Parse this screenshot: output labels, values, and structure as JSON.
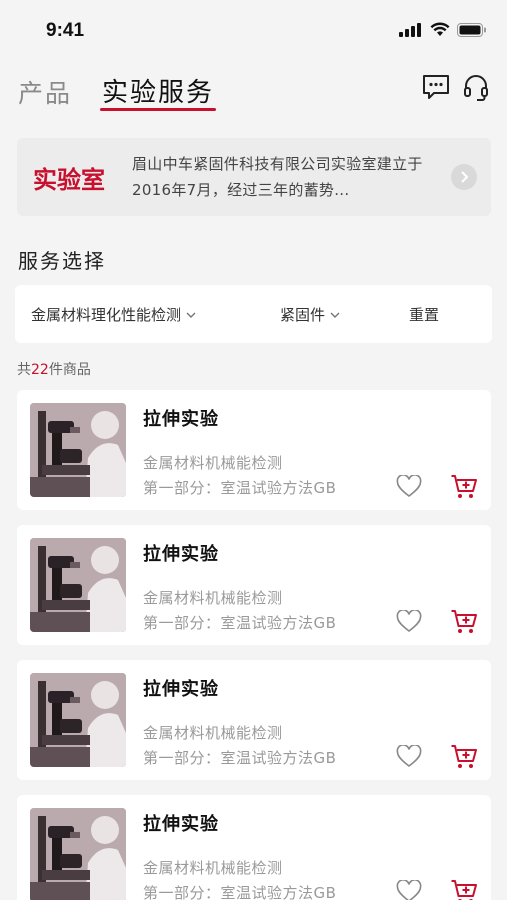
{
  "status_bar": {
    "time": "9:41"
  },
  "top_nav": {
    "tabs": [
      {
        "label": "产品",
        "active": false
      },
      {
        "label": "实验服务",
        "active": true
      }
    ],
    "icons": [
      "message-icon",
      "headset-icon"
    ]
  },
  "banner": {
    "logo_text": "实验室",
    "text": "眉山中车紧固件科技有限公司实验室建立于2016年7月，经过三年的蓄势...",
    "arrow_icon": "chevron-right-icon"
  },
  "section": {
    "title": "服务选择"
  },
  "filters": {
    "category": "金属材料理化性能检测",
    "type": "紧固件",
    "reset": "重置"
  },
  "count": {
    "prefix": "共",
    "number": "22",
    "suffix": "件商品"
  },
  "products": [
    {
      "title": "拉伸实验",
      "subtitle": "金属材料机械能检测",
      "description": "第一部分：室温试验方法GB"
    },
    {
      "title": "拉伸实验",
      "subtitle": "金属材料机械能检测",
      "description": "第一部分：室温试验方法GB"
    },
    {
      "title": "拉伸实验",
      "subtitle": "金属材料机械能检测",
      "description": "第一部分：室温试验方法GB"
    },
    {
      "title": "拉伸实验",
      "subtitle": "金属材料机械能检测",
      "description": "第一部分：室温试验方法GB"
    }
  ],
  "colors": {
    "accent": "#c8102e",
    "background": "#f4f4f4",
    "card": "#ffffff"
  }
}
